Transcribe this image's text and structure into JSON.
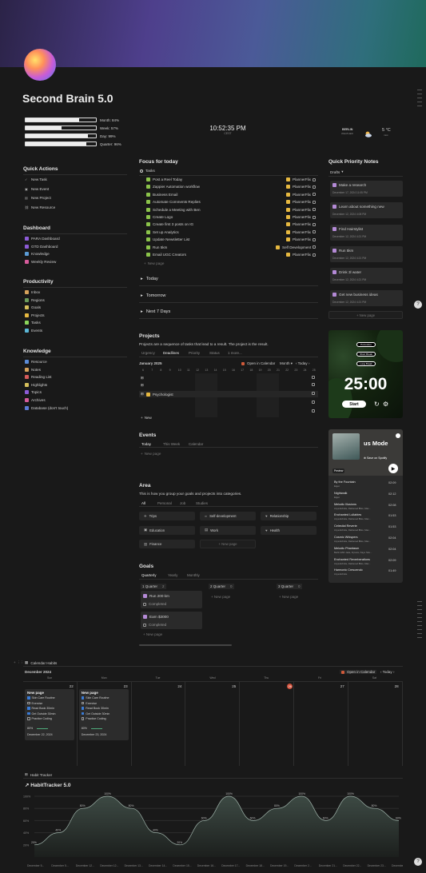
{
  "title": "Second Brain 5.0",
  "progress": [
    {
      "label": "Month: 84%",
      "value": 0.84
    },
    {
      "label": "Week: 57%",
      "value": 0.57
    },
    {
      "label": "Day: 99%",
      "value": 0.99
    },
    {
      "label": "Quarter: 96%",
      "value": 0.96
    }
  ],
  "clock": {
    "time": "10:52:35 PM",
    "tz": "CEST"
  },
  "weather": {
    "city": "BERLIN",
    "sub": "WEATHER",
    "temp": "5 °C",
    "desc": "mist"
  },
  "quick_actions": {
    "header": "Quick Actions",
    "items": [
      "New Task",
      "New Event",
      "New Project",
      "New Resource"
    ]
  },
  "dashboard": {
    "header": "Dashboard",
    "items": [
      "PARA Dashboard",
      "GTD Dashboard",
      "Knowledge",
      "Weekly Review"
    ]
  },
  "productivity": {
    "header": "Productivity",
    "items": [
      "Inbox",
      "Regions",
      "Goals",
      "Projects",
      "Tasks",
      "Events"
    ]
  },
  "knowledge": {
    "header": "Knowledge",
    "items": [
      "Resource",
      "Notes",
      "Reading List",
      "Highlights",
      "Topics",
      "Archives",
      "Database (don't touch)"
    ]
  },
  "focus": {
    "header": "Focus for today",
    "view": "Tasks",
    "tasks": [
      {
        "name": "Post a Reel Today",
        "project": "PlannerFlix"
      },
      {
        "name": "Zappier Automation workflow",
        "project": "PlannerFlix"
      },
      {
        "name": "Business Email",
        "project": "PlannerFlix"
      },
      {
        "name": "Automate Comments Replies",
        "project": "PlannerFlix"
      },
      {
        "name": "Schedule a Meeting with Ben",
        "project": "PlannerFlix"
      },
      {
        "name": "Create Logo",
        "project": "PlannerFlix"
      },
      {
        "name": "Create first 3 posts on IG",
        "project": "PlannerFlix"
      },
      {
        "name": "Set up Analytics",
        "project": "PlannerFlix"
      },
      {
        "name": "Update Newsletter List",
        "project": "PlannerFlix"
      },
      {
        "name": "Run 5km",
        "project": "Self Development"
      },
      {
        "name": "Email UGC Creators",
        "project": "PlannerFlix"
      }
    ],
    "new_page": "New page",
    "groups": [
      "Today",
      "Tomorrow",
      "Next 7 Days"
    ]
  },
  "notes": {
    "header": "Quick Priority Notes",
    "view": "Drafts",
    "items": [
      {
        "title": "Make a research",
        "date": "December 17, 2024 11:05 PM"
      },
      {
        "title": "Learn about something new",
        "date": "December 12, 2024 4:08 PM"
      },
      {
        "title": "Find Hairstylist",
        "date": "December 12, 2024 4:21 PM"
      },
      {
        "title": "Run 5km",
        "date": "December 12, 2024 4:21 PM"
      },
      {
        "title": "Drink 3l water",
        "date": "December 12, 2024 4:21 PM"
      },
      {
        "title": "Get new business ideas",
        "date": "December 12, 2024 4:21 PM"
      }
    ],
    "new_page": "New page"
  },
  "projects": {
    "header": "Projects",
    "desc": "Projects are a sequence of tasks that lead to a result. The project is the result.",
    "tabs": [
      "Urgency",
      "Deadlines",
      "Priority",
      "Status",
      "1 more..."
    ],
    "month": "January 2025",
    "open_cal": "Open in Calendar",
    "range": "Month",
    "today": "Today",
    "days": [
      "6",
      "7",
      "8",
      "9",
      "10",
      "11",
      "12",
      "13",
      "14",
      "15",
      "16",
      "17",
      "18",
      "19",
      "20",
      "21",
      "22",
      "23",
      "24",
      "25"
    ],
    "row": "Psychologist",
    "new": "New"
  },
  "events": {
    "header": "Events",
    "tabs": [
      "Today",
      "This Week",
      "Calendar"
    ],
    "new_page": "New page"
  },
  "area": {
    "header": "Area",
    "desc": "This is how you group your goals and projects into categories.",
    "tabs": [
      "All",
      "Personal",
      "Job",
      "Studies"
    ],
    "items": [
      "Trips",
      "Self-development",
      "Relationship",
      "Education",
      "Work",
      "Health",
      "Finance"
    ],
    "new_page": "New page"
  },
  "goals": {
    "header": "Goals",
    "tabs": [
      "Quarterly",
      "Yearly",
      "Monthly"
    ],
    "cols": [
      {
        "name": "1 Quarter",
        "count": "2"
      },
      {
        "name": "2 Quarter",
        "count": "0"
      },
      {
        "name": "3 Quarter",
        "count": "0"
      }
    ],
    "cards": [
      {
        "title": "Run 200 km",
        "tag": "Completed"
      },
      {
        "title": "Earn $3000",
        "tag": "Completed"
      }
    ],
    "new_page": "New page"
  },
  "pomodoro": {
    "modes": [
      "Pomodoro",
      "Short Break",
      "Long Break"
    ],
    "time": "25:00",
    "start": "Start"
  },
  "spotify": {
    "title": "us Mode",
    "sub": "Spotify",
    "save": "Save on Spotify",
    "preview": "Preview",
    "tracks": [
      {
        "name": "By the Fountain",
        "artist": "Eigen",
        "dur": "02:09"
      },
      {
        "name": "Nightwalk",
        "artist": "Eigen",
        "dur": "02:12"
      },
      {
        "name": "Melodic Illusions",
        "artist": "Anya Echolie, Darkened Bliss, Max...",
        "dur": "02:08"
      },
      {
        "name": "Enchanted Lullabies",
        "artist": "Anya Echolie, Darkened Bliss, Max...",
        "dur": "01:53"
      },
      {
        "name": "Celestial Reverie",
        "artist": "Anya Echolie, Darkened Bliss, Max...",
        "dur": "01:53"
      },
      {
        "name": "Cosmic Whispers",
        "artist": "Anya Echolie, Darkened Bliss, Max...",
        "dur": "02:04"
      },
      {
        "name": "Melodic Phantasm",
        "artist": "Berlin ESK Jade, Dj Hotu, Kayo Stre...",
        "dur": "02:04"
      },
      {
        "name": "Enchanted Reverberations",
        "artist": "Anya Echolie, Darkened Bliss, Max...",
        "dur": "02:09"
      },
      {
        "name": "Harmonic Crescendo",
        "artist": "Anya Echolie",
        "dur": "01:49"
      }
    ]
  },
  "habits": {
    "view": "Calendar Habits",
    "month": "December 2024",
    "open_cal": "Open in Calendar",
    "today": "Today",
    "weekdays": [
      "Sun",
      "Mon",
      "Tue",
      "Wed",
      "Thu",
      "Fri",
      "Sat"
    ],
    "dates": [
      "22",
      "23",
      "24",
      "25",
      "26",
      "27",
      "28"
    ],
    "cards": [
      {
        "title": "New page",
        "items": [
          "Skin Care Routine",
          "Exercise",
          "Read Book 30min",
          "Get Outside 30min",
          "Practice Coding"
        ],
        "checked": [
          true,
          false,
          true,
          true,
          false
        ],
        "percent": "80%",
        "date": "December 22, 2024"
      },
      {
        "title": "New page",
        "items": [
          "Skin Care Routine",
          "Exercise",
          "Read Book 30min",
          "Get Outside 30min",
          "Practice Coding"
        ],
        "checked": [
          true,
          false,
          true,
          true,
          false
        ],
        "percent": "80%",
        "date": "December 23, 2024"
      }
    ]
  },
  "tracker": {
    "view": "Habit Tracker",
    "title": "HabitTracker 5.0"
  },
  "chart_data": {
    "type": "area",
    "title": "",
    "x": [
      "December 5...",
      "December 5...",
      "December 12...",
      "December 12...",
      "December 13...",
      "December 14...",
      "December 15...",
      "December 16...",
      "December 17...",
      "December 18...",
      "December 19...",
      "December 2...",
      "December 21...",
      "December 22...",
      "December 23...",
      "December 24..."
    ],
    "yticks": [
      "100%",
      "80%",
      "60%",
      "40%",
      "20%"
    ],
    "ylim": [
      0,
      100
    ],
    "values": [
      20,
      40,
      80,
      100,
      80,
      40,
      20,
      60,
      100,
      60,
      80,
      100,
      60,
      100,
      80,
      60
    ],
    "labels": [
      "20%",
      "40%",
      "80%",
      "100%",
      "80%",
      "40%",
      "20%",
      "60%",
      "100%",
      "60%",
      "80%",
      "100%",
      "60%",
      "100%",
      "80%",
      "60%"
    ]
  }
}
